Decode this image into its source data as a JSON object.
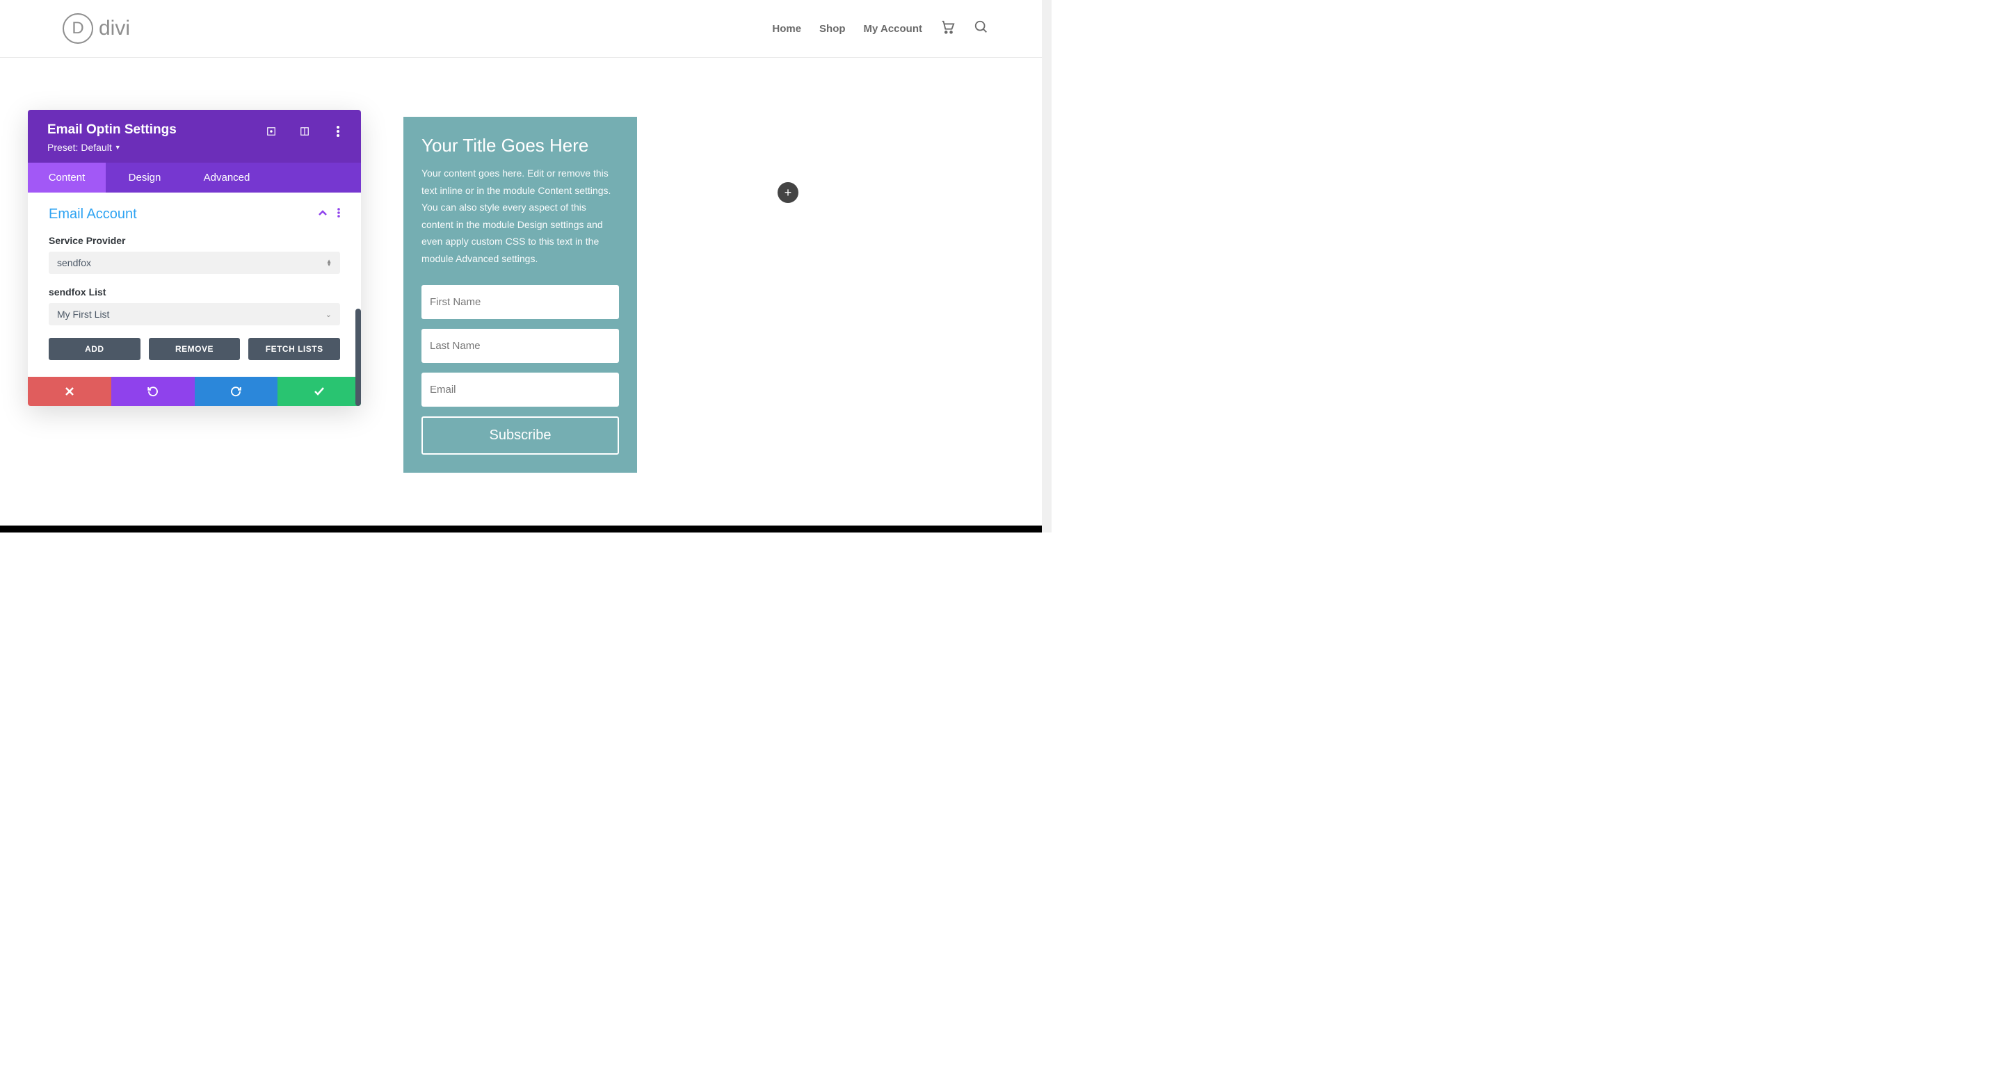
{
  "header": {
    "logo_letter": "D",
    "logo_text": "divi",
    "nav": [
      "Home",
      "Shop",
      "My Account"
    ]
  },
  "panel": {
    "title": "Email Optin Settings",
    "preset_label": "Preset:",
    "preset_value": "Default",
    "tabs": [
      "Content",
      "Design",
      "Advanced"
    ],
    "section_title": "Email Account",
    "provider_label": "Service Provider",
    "provider_value": "sendfox",
    "list_label": "sendfox List",
    "list_value": "My First List",
    "buttons": {
      "add": "ADD",
      "remove": "REMOVE",
      "fetch": "FETCH LISTS"
    }
  },
  "optin": {
    "title": "Your Title Goes Here",
    "desc": "Your content goes here. Edit or remove this text inline or in the module Content settings. You can also style every aspect of this content in the module Design settings and even apply custom CSS to this text in the module Advanced settings.",
    "first_name_ph": "First Name",
    "last_name_ph": "Last Name",
    "email_ph": "Email",
    "submit": "Subscribe"
  }
}
